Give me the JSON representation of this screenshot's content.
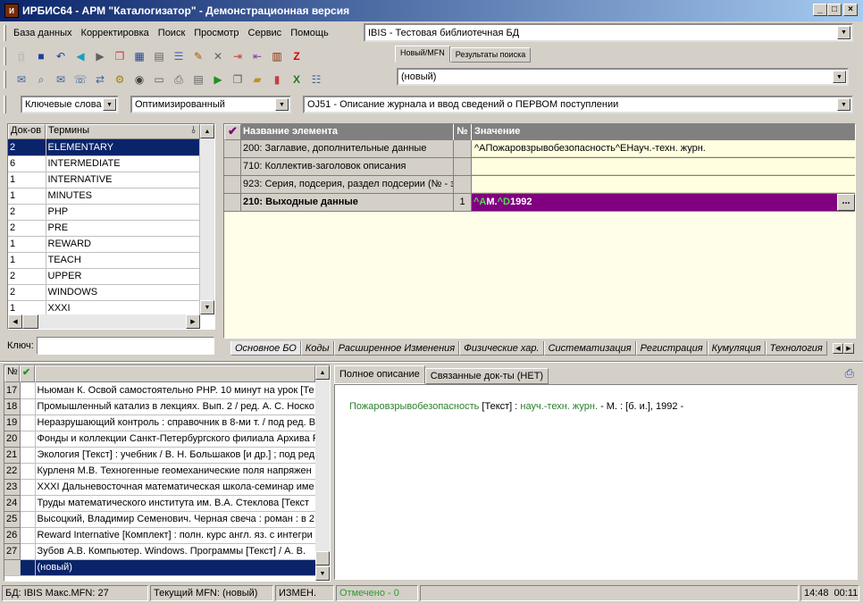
{
  "window": {
    "title": "ИРБИС64 - АРМ \"Каталогизатор\" - Демонстрационная версия",
    "app_icon": "irbis-app-icon"
  },
  "menu": [
    "База данных",
    "Корректировка",
    "Поиск",
    "Просмотр",
    "Сервис",
    "Помощь"
  ],
  "db_select": "IBIS - Тестовая библиотечная БД",
  "record_tabs": [
    "Новый/MFN",
    "Результаты поиска"
  ],
  "record_select": "(новый)",
  "search_mode": "Ключевые слова",
  "worksheet_mode": "Оптимизированный",
  "worksheet": "OJ51 - Описание журнала и ввод сведений о ПЕРВОМ поступлении",
  "dict": {
    "col_docs": "Док-ов",
    "col_terms": "Термины",
    "rows": [
      [
        "2",
        "ELEMENTARY"
      ],
      [
        "6",
        "INTERMEDIATE"
      ],
      [
        "1",
        "INTERNATIVE"
      ],
      [
        "1",
        "MINUTES"
      ],
      [
        "2",
        "PHP"
      ],
      [
        "2",
        "PRE"
      ],
      [
        "1",
        "REWARD"
      ],
      [
        "1",
        "TEACH"
      ],
      [
        "2",
        "UPPER"
      ],
      [
        "2",
        "WINDOWS"
      ],
      [
        "1",
        "XXXI"
      ]
    ],
    "key_label": "Ключ:",
    "key_value": ""
  },
  "editor": {
    "col_name": "Название элемента",
    "col_no": "№",
    "col_value": "Значение",
    "rows": [
      {
        "name": "200: Заглавие, дополнительные данные",
        "no": "",
        "value": "^AПожаровзрывобезопасность^EНауч.-техн. журн."
      },
      {
        "name": "710: Коллектив-заголовок описания",
        "no": "",
        "value": ""
      },
      {
        "name": "923: Серия, подсерия, раздел подсерии (№ - за",
        "no": "",
        "value": ""
      },
      {
        "name": "210: Выходные данные",
        "no": "1",
        "value_parts": [
          "^A",
          "М.",
          "^D",
          "1992"
        ]
      }
    ],
    "ellipsis": "..."
  },
  "page_tabs": [
    "Основное БО",
    "Коды",
    "Расширенное Изменения",
    "Физические хар.",
    "Систематизация",
    "Регистрация",
    "Кумуляция",
    "Технология"
  ],
  "results": {
    "col_no": "№",
    "rows": [
      [
        "17",
        "Ньюман К. Освой самостоятельно PHP. 10 минут на урок [Те"
      ],
      [
        "18",
        "Промышленный катализ в лекциях. Вып. 2 / ред. А. С. Носко"
      ],
      [
        "19",
        "Неразрушающий контроль : справочник в 8-ми т. / под ред. В"
      ],
      [
        "20",
        "Фонды и коллекции Санкт-Петербургского филиала Архива Р"
      ],
      [
        "21",
        "Экология [Текст] : учебник / В. Н. Большаков [и др.] ; под ред."
      ],
      [
        "22",
        "Курленя М.В. Техногенные геомеханические поля напряжен"
      ],
      [
        "23",
        "XXXI Дальневосточная математическая школа-семинар име"
      ],
      [
        "24",
        "Труды математического института им. В.А. Стеклова [Текст"
      ],
      [
        "25",
        "Высоцкий, Владимир Семенович. Черная свеча : роман : в 2"
      ],
      [
        "26",
        "Reward Internative [Комплект] : полн. курс англ. яз. с интегри"
      ],
      [
        "27",
        "Зубов А.В. Компьютер. Windows. Программы [Текст] / А. В."
      ]
    ],
    "new_row": "(новый)"
  },
  "preview": {
    "tabs": [
      "Полное описание",
      "Связанные док-ты (НЕТ)"
    ],
    "parts": [
      "Пожаровзрывобезопасность",
      " [Текст] : ",
      "науч.-техн. журн.",
      " - М. : [б. и.], 1992 -"
    ]
  },
  "status": {
    "db": "БД: IBIS Макс.MFN: 27",
    "current": "Текущий MFN: (новый)",
    "changed": "ИЗМЕН.",
    "marked": "Отмечено - 0",
    "time1": "14:48",
    "time2": "00:11"
  },
  "colors": {
    "title_start": "#0a246a",
    "selection": "#0a246a",
    "field_highlight": "#800080",
    "editor_bg": "#fffee8",
    "preview_green": "#2e7d2e"
  }
}
